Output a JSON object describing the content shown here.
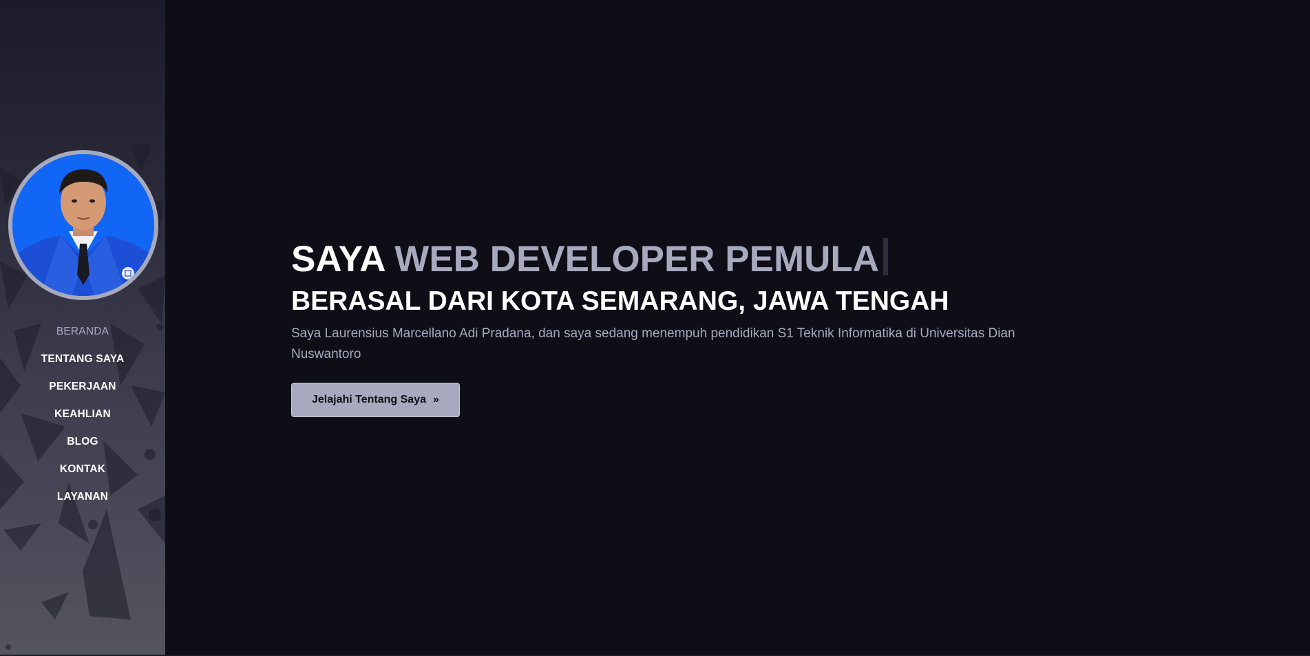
{
  "sidebar": {
    "avatar_alt": "profile-photo",
    "nav_items": [
      {
        "label": "BERANDA",
        "active": true
      },
      {
        "label": "TENTANG SAYA",
        "active": false
      },
      {
        "label": "PEKERJAAN",
        "active": false
      },
      {
        "label": "KEAHLIAN",
        "active": false
      },
      {
        "label": "BLOG",
        "active": false
      },
      {
        "label": "KONTAK",
        "active": false
      },
      {
        "label": "LAYANAN",
        "active": false
      }
    ]
  },
  "hero": {
    "headline_prefix": "SAYA",
    "headline_typed": "WEB DEVELOPER PEMULA",
    "subheadline": "BERASAL DARI KOTA SEMARANG, JAWA TENGAH",
    "description": "Saya Laurensius Marcellano Adi Pradana, dan saya sedang menempuh pendidikan S1 Teknik Informatika di Universitas Dian Nuswantoro",
    "cta_label": "Jelajahi Tentang Saya",
    "cta_icon": "double-chevron-right-icon",
    "cta_glyph": "»"
  },
  "colors": {
    "background": "#0f0e17",
    "headline": "#fffffe",
    "accent": "#a7a9be",
    "avatar_bg": "#1266f5"
  }
}
